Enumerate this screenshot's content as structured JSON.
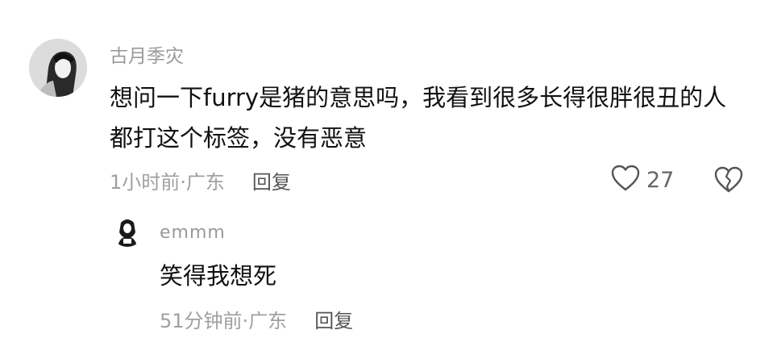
{
  "comment": {
    "username": "古月季灾",
    "text": "想问一下furry是猪的意思吗，我看到很多长得很胖很丑的人都打这个标签，没有恶意",
    "time": "1小时前",
    "location": "广东",
    "reply_label": "回复",
    "like_count": "27"
  },
  "reply": {
    "username": "emmm",
    "text": "笑得我想死",
    "time": "51分钟前",
    "location": "广东",
    "reply_label": "回复"
  },
  "meta_separator": "·",
  "icons": {
    "like": "heart-outline-icon",
    "dislike": "broken-heart-icon"
  }
}
